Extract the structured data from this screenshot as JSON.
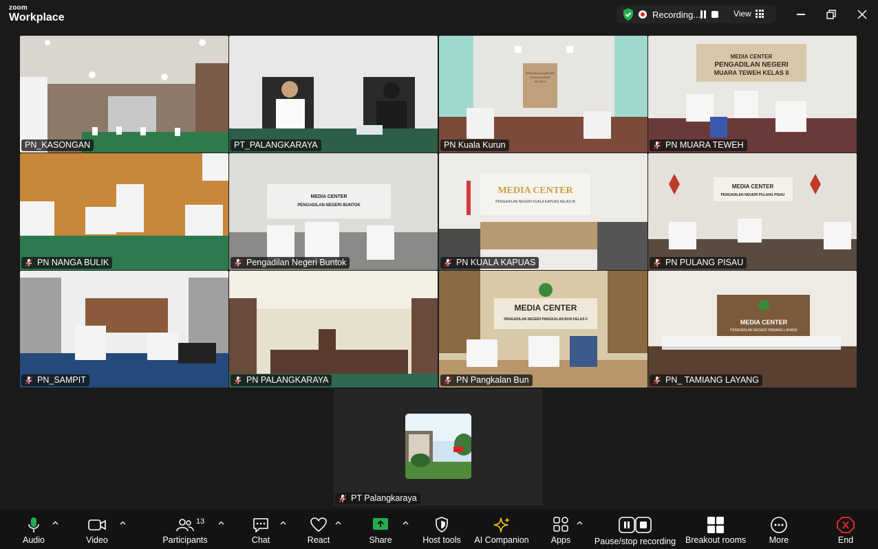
{
  "app": {
    "brand_small": "zoom",
    "brand_big": "Workplace"
  },
  "topbar": {
    "recording_label": "Recording...",
    "view_label": "View",
    "colors": {
      "shield": "#1fb04d",
      "rec": "#e02828"
    }
  },
  "participants": [
    {
      "name": "PN_KASONGAN",
      "muted": false
    },
    {
      "name": "PT_PALANGKARAYA",
      "muted": false,
      "active": true
    },
    {
      "name": "PN Kuala Kurun",
      "muted": false
    },
    {
      "name": "PN MUARA TEWEH",
      "muted": true
    },
    {
      "name": "PN NANGA BULIK",
      "muted": true
    },
    {
      "name": "Pengadilan Negeri Buntok",
      "muted": true
    },
    {
      "name": "PN KUALA KAPUAS",
      "muted": true
    },
    {
      "name": "PN PULANG PISAU",
      "muted": true
    },
    {
      "name": "PN_SAMPIT",
      "muted": true
    },
    {
      "name": "PN PALANGKARAYA",
      "muted": true
    },
    {
      "name": "PN Pangkalan Bun",
      "muted": true
    },
    {
      "name": "PN_ TAMIANG LAYANG",
      "muted": true
    }
  ],
  "self_view": {
    "name": "PT Palangkaraya",
    "muted": true
  },
  "toolbar": {
    "audio": "Audio",
    "video": "Video",
    "participants": "Participants",
    "participants_count": "13",
    "chat": "Chat",
    "react": "React",
    "share": "Share",
    "host_tools": "Host tools",
    "ai_companion": "AI Companion",
    "apps": "Apps",
    "pause_stop_recording": "Pause/stop recording",
    "breakout_rooms": "Breakout rooms",
    "more": "More",
    "end": "End",
    "colors": {
      "share": "#1fb04d",
      "end": "#e02828",
      "ai": "#f5c518"
    }
  },
  "scene_signs": {
    "tile_2": [
      "PENGADILAN NEGERI",
      "KUALA KURUN",
      "KELAS II"
    ],
    "tile_3": [
      "MEDIA CENTER",
      "PENGADILAN NEGERI",
      "MUARA TEWEH KELAS II"
    ],
    "tile_5": [
      "MEDIA CENTER",
      "PENGADILAN NEGERI BUNTOK"
    ],
    "tile_6": [
      "MEDIA CENTER",
      "PENGADILAN NEGERI KUALA KAPUAS KELAS IB"
    ],
    "tile_7": [
      "MEDIA CENTER",
      "PENGADILAN NEGERI PULANG PISAU"
    ],
    "tile_10": [
      "MEDIA CENTER",
      "PENGADILAN NEGERI PANGKALAN BUN KELAS II"
    ],
    "tile_11": [
      "MEDIA CENTER",
      "PENGADILAN NEGERI TAMIANG LAYANG"
    ]
  }
}
